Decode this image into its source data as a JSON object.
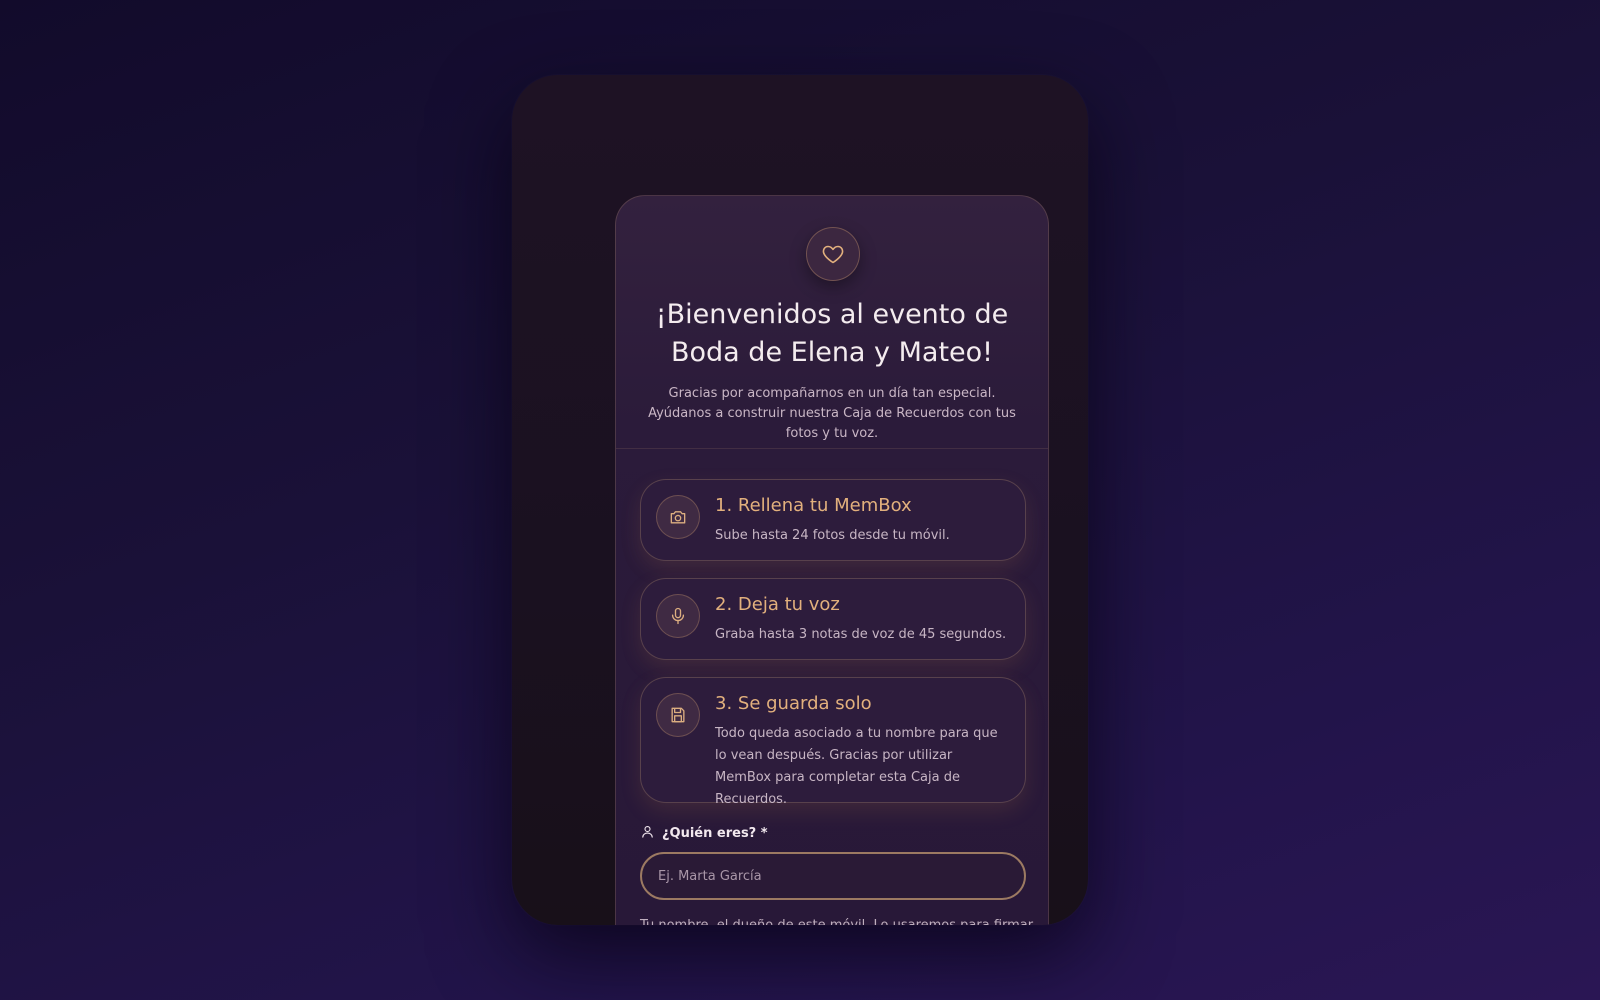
{
  "header": {
    "icon": "heart-icon",
    "title": "¡Bienvenidos al evento de Boda de Elena y Mateo!",
    "subtitle": "Gracias por acompañarnos en un día tan especial. Ayúdanos a construir nuestra Caja de Recuerdos con tus fotos y tu voz."
  },
  "steps": [
    {
      "icon": "camera-icon",
      "title": "1. Rellena tu MemBox",
      "description": "Sube hasta 24 fotos desde tu móvil."
    },
    {
      "icon": "microphone-icon",
      "title": "2. Deja tu voz",
      "description": "Graba hasta 3 notas de voz de 45 segundos."
    },
    {
      "icon": "save-icon",
      "title": "3. Se guarda solo",
      "description": "Todo queda asociado a tu nombre para que lo vean después. Gracias por utilizar MemBox para completar esta Caja de Recuerdos."
    }
  ],
  "name_field": {
    "icon": "user-icon",
    "label": "¿Quién eres? *",
    "value": "",
    "placeholder": "Ej. Marta García",
    "helper": "Tu nombre, el dueño de este móvil. Lo usaremos para firmar"
  },
  "colors": {
    "accent": "#e2b07d",
    "card_bg": "#2d1c3c",
    "page_bg": "#1a1138"
  }
}
